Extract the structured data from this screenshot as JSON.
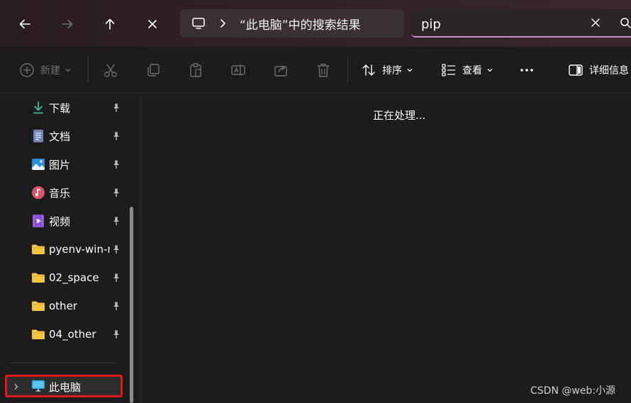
{
  "address": {
    "path": "“此电脑”中的搜索结果"
  },
  "search": {
    "value": "pip"
  },
  "toolbar": {
    "new_label": "新建",
    "sort_label": "排序",
    "view_label": "查看",
    "details_label": "详细信息"
  },
  "sidebar": {
    "items": [
      {
        "label": "下载",
        "icon": "download-icon"
      },
      {
        "label": "文档",
        "icon": "document-icon"
      },
      {
        "label": "图片",
        "icon": "pictures-icon"
      },
      {
        "label": "音乐",
        "icon": "music-icon"
      },
      {
        "label": "视频",
        "icon": "video-icon"
      },
      {
        "label": "pyenv-win-master",
        "icon": "folder-icon"
      },
      {
        "label": "02_space",
        "icon": "folder-icon"
      },
      {
        "label": "other",
        "icon": "folder-icon"
      },
      {
        "label": "04_other",
        "icon": "folder-icon"
      }
    ],
    "this_pc_label": "此电脑"
  },
  "content": {
    "status": "正在处理..."
  },
  "watermark": "CSDN @web:小源",
  "colors": {
    "accent_underline": "#c98fc7",
    "highlight_box": "#e0191b",
    "folder": "#f6c344"
  }
}
